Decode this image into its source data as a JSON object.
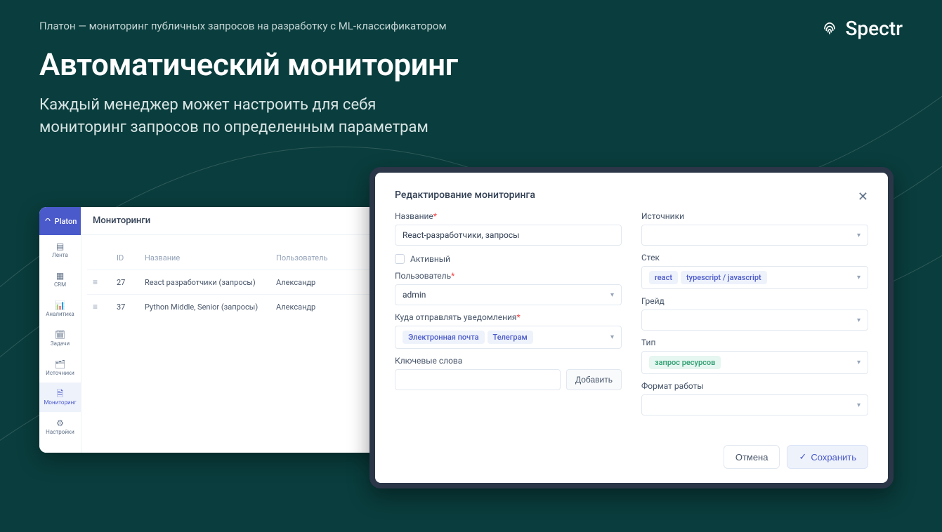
{
  "header": {
    "breadcrumb": "Платон — мониторинг публичных запросов на разработку с ML-классификатором",
    "brand": "Spectr",
    "title": "Автоматический мониторинг",
    "subtitle": "Каждый менеджер может настроить для себя мониторинг запросов по определенным параметрам"
  },
  "left_panel": {
    "app_name": "Platon",
    "page_title": "Мониторинги",
    "sidebar": [
      {
        "label": "Лента"
      },
      {
        "label": "CRM"
      },
      {
        "label": "Аналитика"
      },
      {
        "label": "Задачи"
      },
      {
        "label": "Источники"
      },
      {
        "label": "Мониторинг"
      },
      {
        "label": "Настройки"
      }
    ],
    "table": {
      "columns": {
        "id": "ID",
        "name": "Название",
        "user": "Пользователь"
      },
      "rows": [
        {
          "id": "27",
          "name": "React разработчики (запросы)",
          "user": "Александр"
        },
        {
          "id": "37",
          "name": "Python Middle, Senior (запросы)",
          "user": "Александр"
        }
      ]
    }
  },
  "modal": {
    "title": "Редактирование мониторинга",
    "labels": {
      "name": "Название",
      "active": "Активный",
      "user": "Пользователь",
      "notify": "Куда отправлять уведомления",
      "keywords": "Ключевые слова",
      "sources": "Источники",
      "stack": "Стек",
      "grade": "Грейд",
      "type": "Тип",
      "format": "Формат работы"
    },
    "values": {
      "name": "React-разработчики, запросы",
      "user_selected": "admin",
      "notify_tags": [
        "Электронная почта",
        "Телеграм"
      ],
      "stack_tags": [
        "react",
        "typescript / javascript"
      ],
      "type_tags": [
        "запрос ресурсов"
      ]
    },
    "buttons": {
      "add": "Добавить",
      "cancel": "Отмена",
      "save": "Сохранить"
    }
  }
}
